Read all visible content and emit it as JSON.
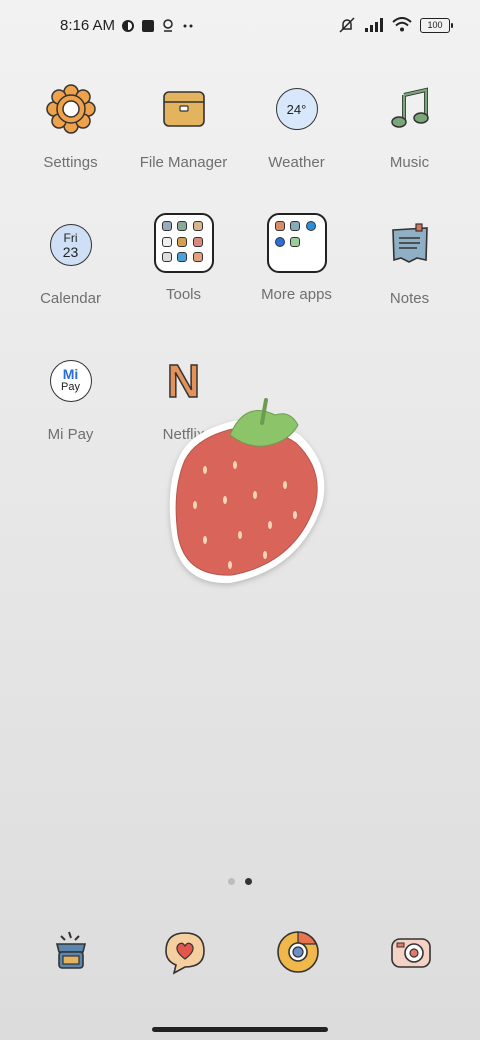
{
  "status_bar": {
    "time": "8:16 AM",
    "battery": "100",
    "left_icons": [
      "circle-status-icon",
      "square-status-icon",
      "location-pin-icon",
      "more-dots-icon"
    ],
    "right_icons": [
      "muted-icon",
      "signal-icon",
      "wifi-icon",
      "battery-icon"
    ]
  },
  "apps": [
    {
      "label": "Settings",
      "icon": "gear-icon"
    },
    {
      "label": "File Manager",
      "icon": "folder-bag-icon"
    },
    {
      "label": "Weather",
      "icon": "weather-icon",
      "icon_text": "24°"
    },
    {
      "label": "Music",
      "icon": "music-note-icon"
    },
    {
      "label": "Calendar",
      "icon": "calendar-icon",
      "day": "Fri",
      "date": "23"
    },
    {
      "label": "Tools",
      "icon": "folder-icon"
    },
    {
      "label": "More apps",
      "icon": "folder-icon"
    },
    {
      "label": "Notes",
      "icon": "notes-icon"
    },
    {
      "label": "Mi Pay",
      "icon": "mipay-icon",
      "icon_top": "Mi",
      "icon_bottom": "Pay"
    },
    {
      "label": "Netflix",
      "icon": "netflix-icon",
      "icon_text": "N"
    }
  ],
  "pages": {
    "count": 2,
    "active": 2
  },
  "dock": [
    {
      "name": "phone-dock",
      "icon": "phone-icon"
    },
    {
      "name": "messages-dock",
      "icon": "heart-chat-icon"
    },
    {
      "name": "chrome-dock",
      "icon": "chrome-icon"
    },
    {
      "name": "camera-dock",
      "icon": "camera-icon"
    }
  ],
  "colors": {
    "background_top": "#f2f2f2",
    "background_bottom": "#dcdcdc",
    "label": "#6f6f6f",
    "strawberry": "#d9655a",
    "strawberry_leaf": "#8cc46a"
  }
}
